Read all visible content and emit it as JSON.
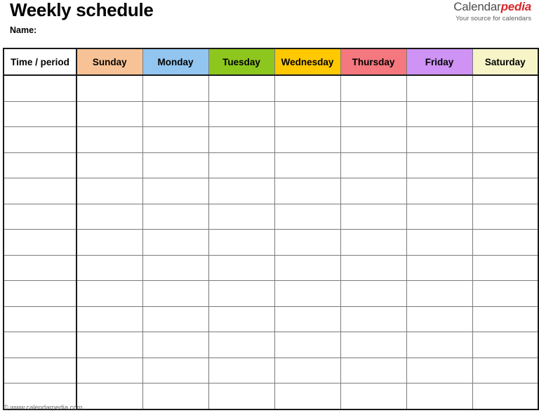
{
  "header": {
    "title": "Weekly schedule",
    "name_label": "Name:",
    "brand_name_dark": "Calendar",
    "brand_name_accent": "pedia",
    "brand_tagline": "Your source for calendars"
  },
  "colors": {
    "accent_red": "#d6272b",
    "sunday": "#f7c396",
    "monday": "#92c5f0",
    "tuesday": "#8dc71e",
    "wednesday": "#ffc800",
    "thursday": "#f4787e",
    "friday": "#ce93f5",
    "saturday": "#f7f5c8",
    "time_column": "#ffffff",
    "grid_line": "#7b7b7b",
    "frame_line": "#1a1a1a"
  },
  "table": {
    "columns": [
      {
        "label": "Time / period",
        "color": "#ffffff"
      },
      {
        "label": "Sunday",
        "color": "#f7c396"
      },
      {
        "label": "Monday",
        "color": "#92c5f0"
      },
      {
        "label": "Tuesday",
        "color": "#8dc71e"
      },
      {
        "label": "Wednesday",
        "color": "#ffc800"
      },
      {
        "label": "Thursday",
        "color": "#f4787e"
      },
      {
        "label": "Friday",
        "color": "#ce93f5"
      },
      {
        "label": "Saturday",
        "color": "#f7f5c8"
      }
    ],
    "row_count": 13,
    "rows": [
      [
        "",
        "",
        "",
        "",
        "",
        "",
        "",
        ""
      ],
      [
        "",
        "",
        "",
        "",
        "",
        "",
        "",
        ""
      ],
      [
        "",
        "",
        "",
        "",
        "",
        "",
        "",
        ""
      ],
      [
        "",
        "",
        "",
        "",
        "",
        "",
        "",
        ""
      ],
      [
        "",
        "",
        "",
        "",
        "",
        "",
        "",
        ""
      ],
      [
        "",
        "",
        "",
        "",
        "",
        "",
        "",
        ""
      ],
      [
        "",
        "",
        "",
        "",
        "",
        "",
        "",
        ""
      ],
      [
        "",
        "",
        "",
        "",
        "",
        "",
        "",
        ""
      ],
      [
        "",
        "",
        "",
        "",
        "",
        "",
        "",
        ""
      ],
      [
        "",
        "",
        "",
        "",
        "",
        "",
        "",
        ""
      ],
      [
        "",
        "",
        "",
        "",
        "",
        "",
        "",
        ""
      ],
      [
        "",
        "",
        "",
        "",
        "",
        "",
        "",
        ""
      ],
      [
        "",
        "",
        "",
        "",
        "",
        "",
        "",
        ""
      ]
    ]
  },
  "footer": {
    "copyright": "© www.calendarpedia.com"
  }
}
